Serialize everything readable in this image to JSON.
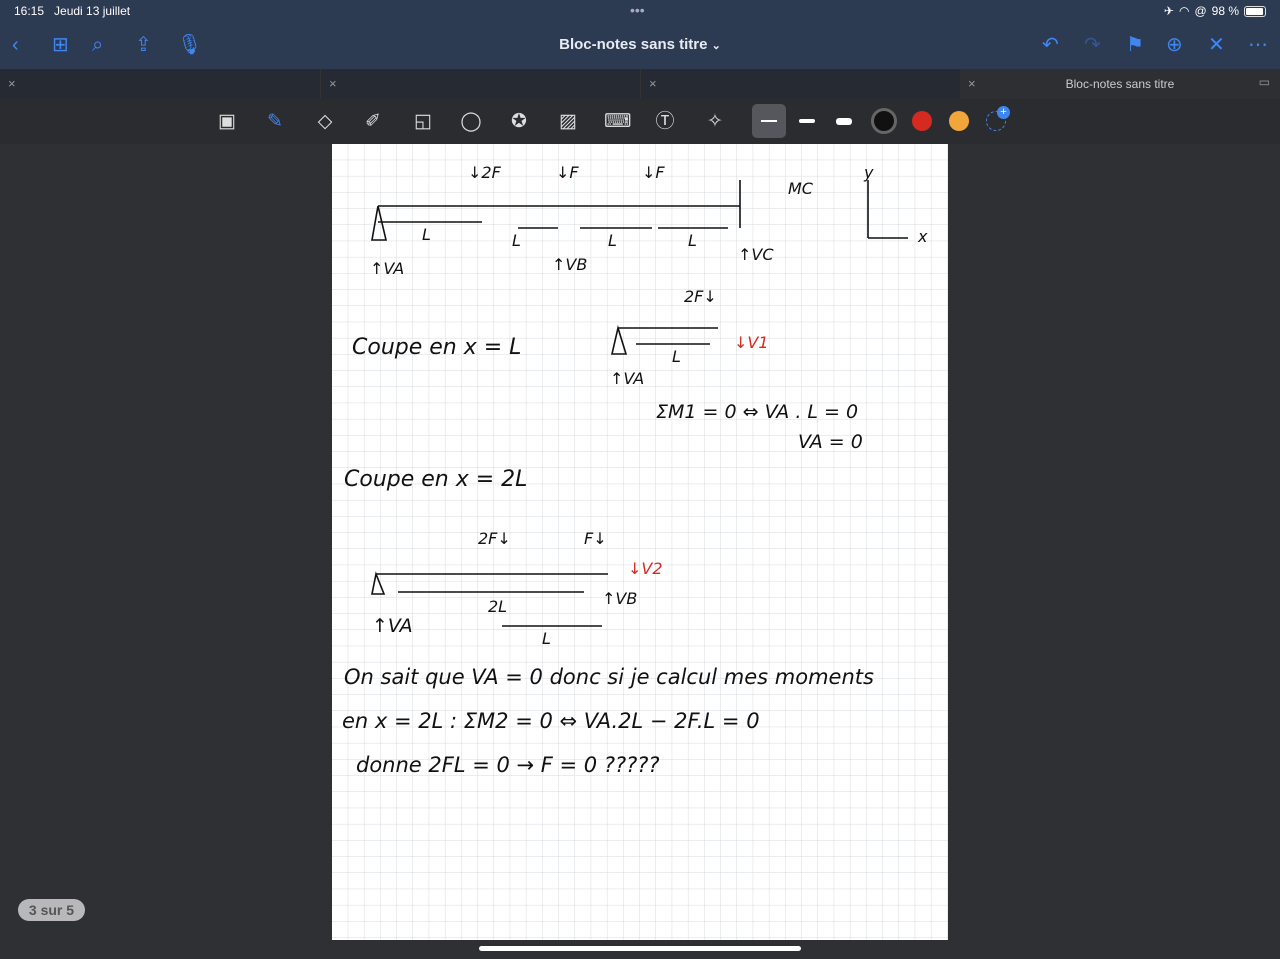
{
  "status": {
    "time": "16:15",
    "date": "Jeudi 13 juillet",
    "battery": "98 %",
    "battery_level": 0.98
  },
  "nav": {
    "title": "Bloc-notes sans titre",
    "chevron": "⌄"
  },
  "tabs": [
    {
      "label": ""
    },
    {
      "label": ""
    },
    {
      "label": ""
    },
    {
      "label": "Bloc-notes sans titre",
      "active": true
    }
  ],
  "toolbar": {
    "colors": [
      "#111111",
      "#d42a20",
      "#f0a63a"
    ],
    "accent": "#3f86f0"
  },
  "notes": {
    "f2": "↓2F",
    "f1": "↓F",
    "f3": "↓F",
    "mc": "MC",
    "y": "y",
    "x": "x",
    "l1": "L",
    "l2": "L",
    "l3": "L",
    "l4": "L",
    "va": "↑VA",
    "vb": "↑VB",
    "vc": "↑VC",
    "c1": "Coupe en x = L",
    "c1f": "2F↓",
    "c1l": "L",
    "c1va": "↑VA",
    "v1": "↓V1",
    "m1": "ΣM1 = 0 ⇔ VA . L = 0",
    "va0": "VA = 0",
    "c2": "Coupe en x = 2L",
    "c2f1": "2F↓",
    "c2f2": "F↓",
    "v2": "↓V2",
    "c2l2": "2L",
    "c2vb": "↑VB",
    "c2va": "↑VA",
    "c2l": "L",
    "line1": "On sait que VA = 0 donc si je calcul mes moments",
    "line2": "en x = 2L : ΣM2 = 0 ⇔ VA.2L − 2F.L = 0",
    "line3": "donne 2FL = 0 → F = 0 ?????"
  },
  "pager": "3 sur 5"
}
